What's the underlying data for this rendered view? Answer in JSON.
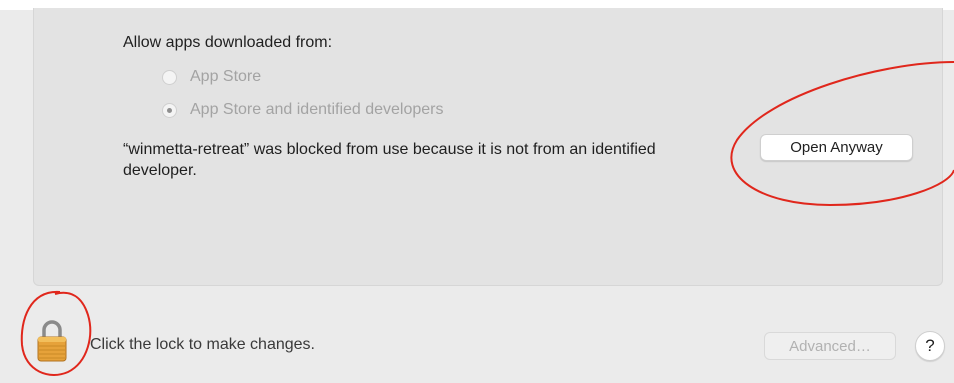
{
  "security": {
    "allow_label": "Allow apps downloaded from:",
    "options": [
      {
        "label": "App Store",
        "selected": false,
        "enabled": false
      },
      {
        "label": "App Store and identified developers",
        "selected": true,
        "enabled": false
      }
    ],
    "blocked_message": "“winmetta-retreat” was blocked from use because it is not from an identified developer.",
    "open_anyway_label": "Open Anyway"
  },
  "footer": {
    "lock_icon": "padlock-icon",
    "lock_text": "Click the lock to make changes.",
    "advanced_label": "Advanced…",
    "help_label": "?"
  },
  "colors": {
    "annotation": "#e0271c",
    "lock_body": "#e6a23a"
  }
}
